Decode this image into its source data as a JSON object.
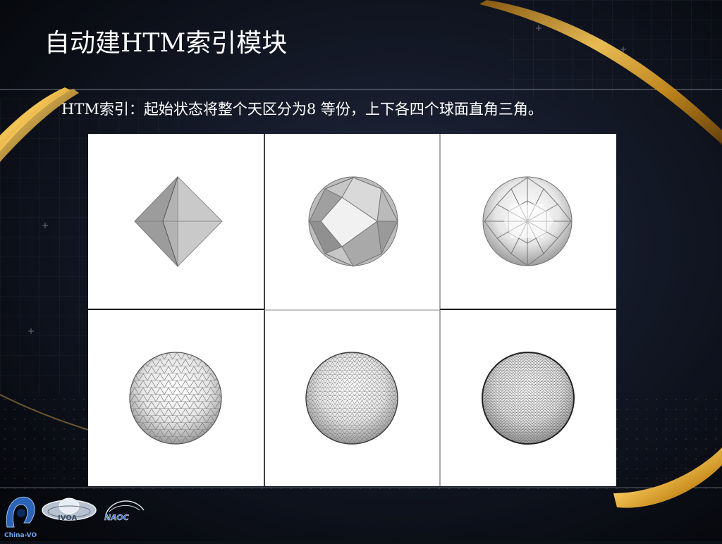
{
  "slide": {
    "title": "自动建HTM索引模块",
    "caption": "HTM索引：起始状态将整个天区分为8 等份，上下各四个球面直角三角。"
  },
  "figure": {
    "panels": [
      {
        "name": "level-0-octahedron"
      },
      {
        "name": "level-1-sphere"
      },
      {
        "name": "level-2-sphere"
      },
      {
        "name": "level-3-sphere"
      },
      {
        "name": "level-4-sphere"
      },
      {
        "name": "level-5-sphere"
      }
    ]
  },
  "logos": {
    "chinavo": "China-VO",
    "ivoa": "IVOA",
    "naoc": "NAOC"
  },
  "colors": {
    "background": "#0c1017",
    "gold": "#d9a532",
    "title_text": "#ffffff"
  }
}
